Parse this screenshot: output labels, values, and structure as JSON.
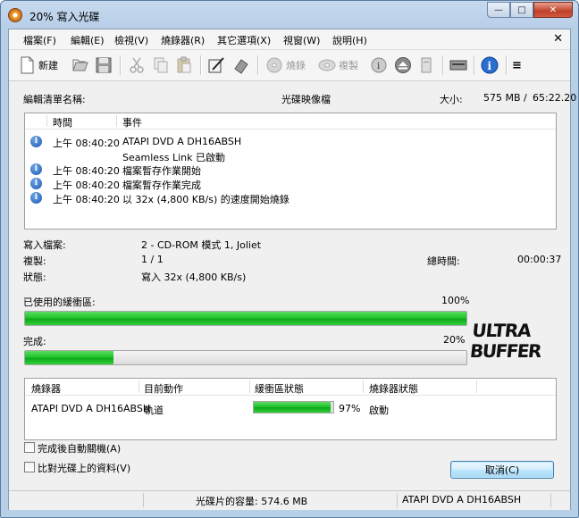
{
  "window": {
    "title": "20% 寫入光碟"
  },
  "menu": [
    "檔案(F)",
    "編輯(E)",
    "檢視(V)",
    "燒錄器(R)",
    "其它選項(X)",
    "視窗(W)",
    "說明(H)"
  ],
  "toolbar": {
    "new_label": "新建",
    "burn_label": "燒錄",
    "copy_label": "複製"
  },
  "compile": {
    "name_label": "編輯清單名稱:",
    "name_value": "光碟映像檔",
    "size_label": "大小:",
    "size_value": "575 MB",
    "duration_value": "65:22.20"
  },
  "log": {
    "col_time": "時間",
    "col_event": "事件",
    "rows": [
      {
        "time": "上午 08:40:20",
        "event": "ATAPI DVD A  DH16ABSH",
        "icon": true
      },
      {
        "time": "",
        "event": "Seamless Link 已啟動",
        "icon": false
      },
      {
        "time": "上午 08:40:20",
        "event": "檔案暫存作業開始",
        "icon": true
      },
      {
        "time": "上午 08:40:20",
        "event": "檔案暫存作業完成",
        "icon": true
      },
      {
        "time": "上午 08:40:20",
        "event": "以 32x (4,800 KB/s) 的速度開始燒錄",
        "icon": true
      }
    ]
  },
  "details": {
    "write_files_label": "寫入檔案:",
    "write_files_value": "2 - CD-ROM 模式 1, Joliet",
    "copies_label": "複製:",
    "copies_value": "1 / 1",
    "total_time_label": "總時間:",
    "total_time_value": "00:00:37",
    "status_label": "狀態:",
    "status_value": "寫入 32x (4,800 KB/s)"
  },
  "progress": {
    "buffer_label": "已使用的緩衝區:",
    "buffer_value": "100%",
    "buffer_fraction": 1.0,
    "done_label": "完成:",
    "done_value": "20%",
    "done_fraction": 0.2
  },
  "logo": {
    "line1": "ULTRA",
    "line2": "BUFFER"
  },
  "drives": {
    "col_recorder": "燒錄器",
    "col_action": "目前動作",
    "col_buffer": "緩衝區狀態",
    "col_status": "燒錄器狀態",
    "rows": [
      {
        "recorder": "ATAPI DVD A  DH16ABSH",
        "action": "軌道",
        "buffer_value": "97%",
        "buffer_fraction": 0.97,
        "status": "啟動"
      }
    ]
  },
  "options": {
    "auto_shutdown_label": "完成後自動關機(A)",
    "verify_label": "比對光碟上的資料(V)"
  },
  "buttons": {
    "cancel_label": "取消(C)"
  },
  "statusbar": {
    "capacity_text": "光碟片的容量: 574.6 MB",
    "drive_text": "ATAPI    DVD A  DH16ABSH"
  },
  "colors": {
    "progress_green": "#22c42c",
    "info_blue": "#1a56b0",
    "title_bar": "#b8cfe8"
  }
}
